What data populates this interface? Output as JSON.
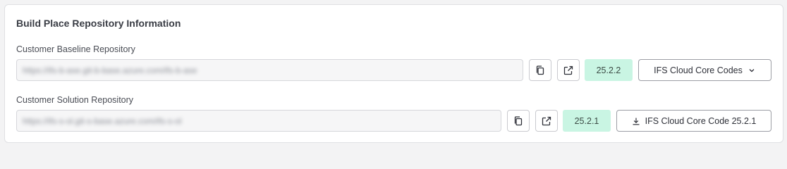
{
  "section": {
    "title": "Build Place Repository Information"
  },
  "baseline": {
    "label": "Customer Baseline Repository",
    "url": "https://ifs-b-ase.git-b-base.azure.com/ifs-b-ase",
    "version": "25.2.2",
    "action_label": "IFS Cloud Core Codes",
    "action_icon": "chevron-down-icon"
  },
  "solution": {
    "label": "Customer Solution Repository",
    "url": "https://ifs-s-ol.git-s-base.azure.com/ifs-s-ol",
    "version": "25.2.1",
    "action_label": "IFS Cloud Core Code 25.2.1",
    "action_icon": "download-icon"
  },
  "icons": {
    "copy": "copy-icon",
    "open": "external-link-icon"
  },
  "colors": {
    "version_badge_bg": "#c9f5e3",
    "card_bg": "#ffffff",
    "page_bg": "#f3f3f4"
  }
}
